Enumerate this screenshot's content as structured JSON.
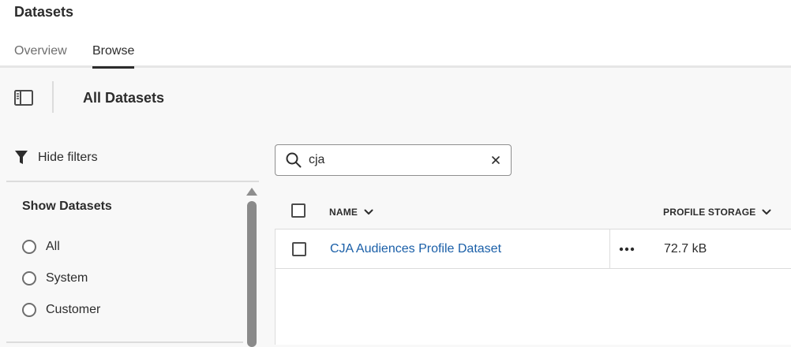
{
  "header": {
    "title": "Datasets",
    "tabs": [
      {
        "label": "Overview",
        "active": false
      },
      {
        "label": "Browse",
        "active": true
      }
    ]
  },
  "toolbar": {
    "section_title": "All Datasets",
    "panel_toggle_icon": "panel-toggle-icon"
  },
  "filters": {
    "toggle_label": "Hide filters",
    "toggle_icon": "funnel-icon",
    "group_title": "Show Datasets",
    "options": [
      {
        "label": "All",
        "selected": false
      },
      {
        "label": "System",
        "selected": false
      },
      {
        "label": "Customer",
        "selected": false
      }
    ]
  },
  "search": {
    "value": "cja",
    "placeholder": "",
    "icon": "search-icon",
    "clear_icon": "close-icon"
  },
  "table": {
    "columns": [
      {
        "label": "NAME",
        "sort_icon": "chevron-down-icon"
      },
      {
        "label": "PROFILE STORAGE",
        "sort_icon": "chevron-down-icon"
      }
    ],
    "rows": [
      {
        "name": "CJA Audiences Profile Dataset",
        "profile_storage": "72.7 kB",
        "selected": false
      }
    ]
  },
  "colors": {
    "link": "#1a5fa8",
    "text": "#2c2c2c",
    "muted": "#6e6e6e",
    "border": "#dcdcdc",
    "background": "#f8f8f8"
  }
}
